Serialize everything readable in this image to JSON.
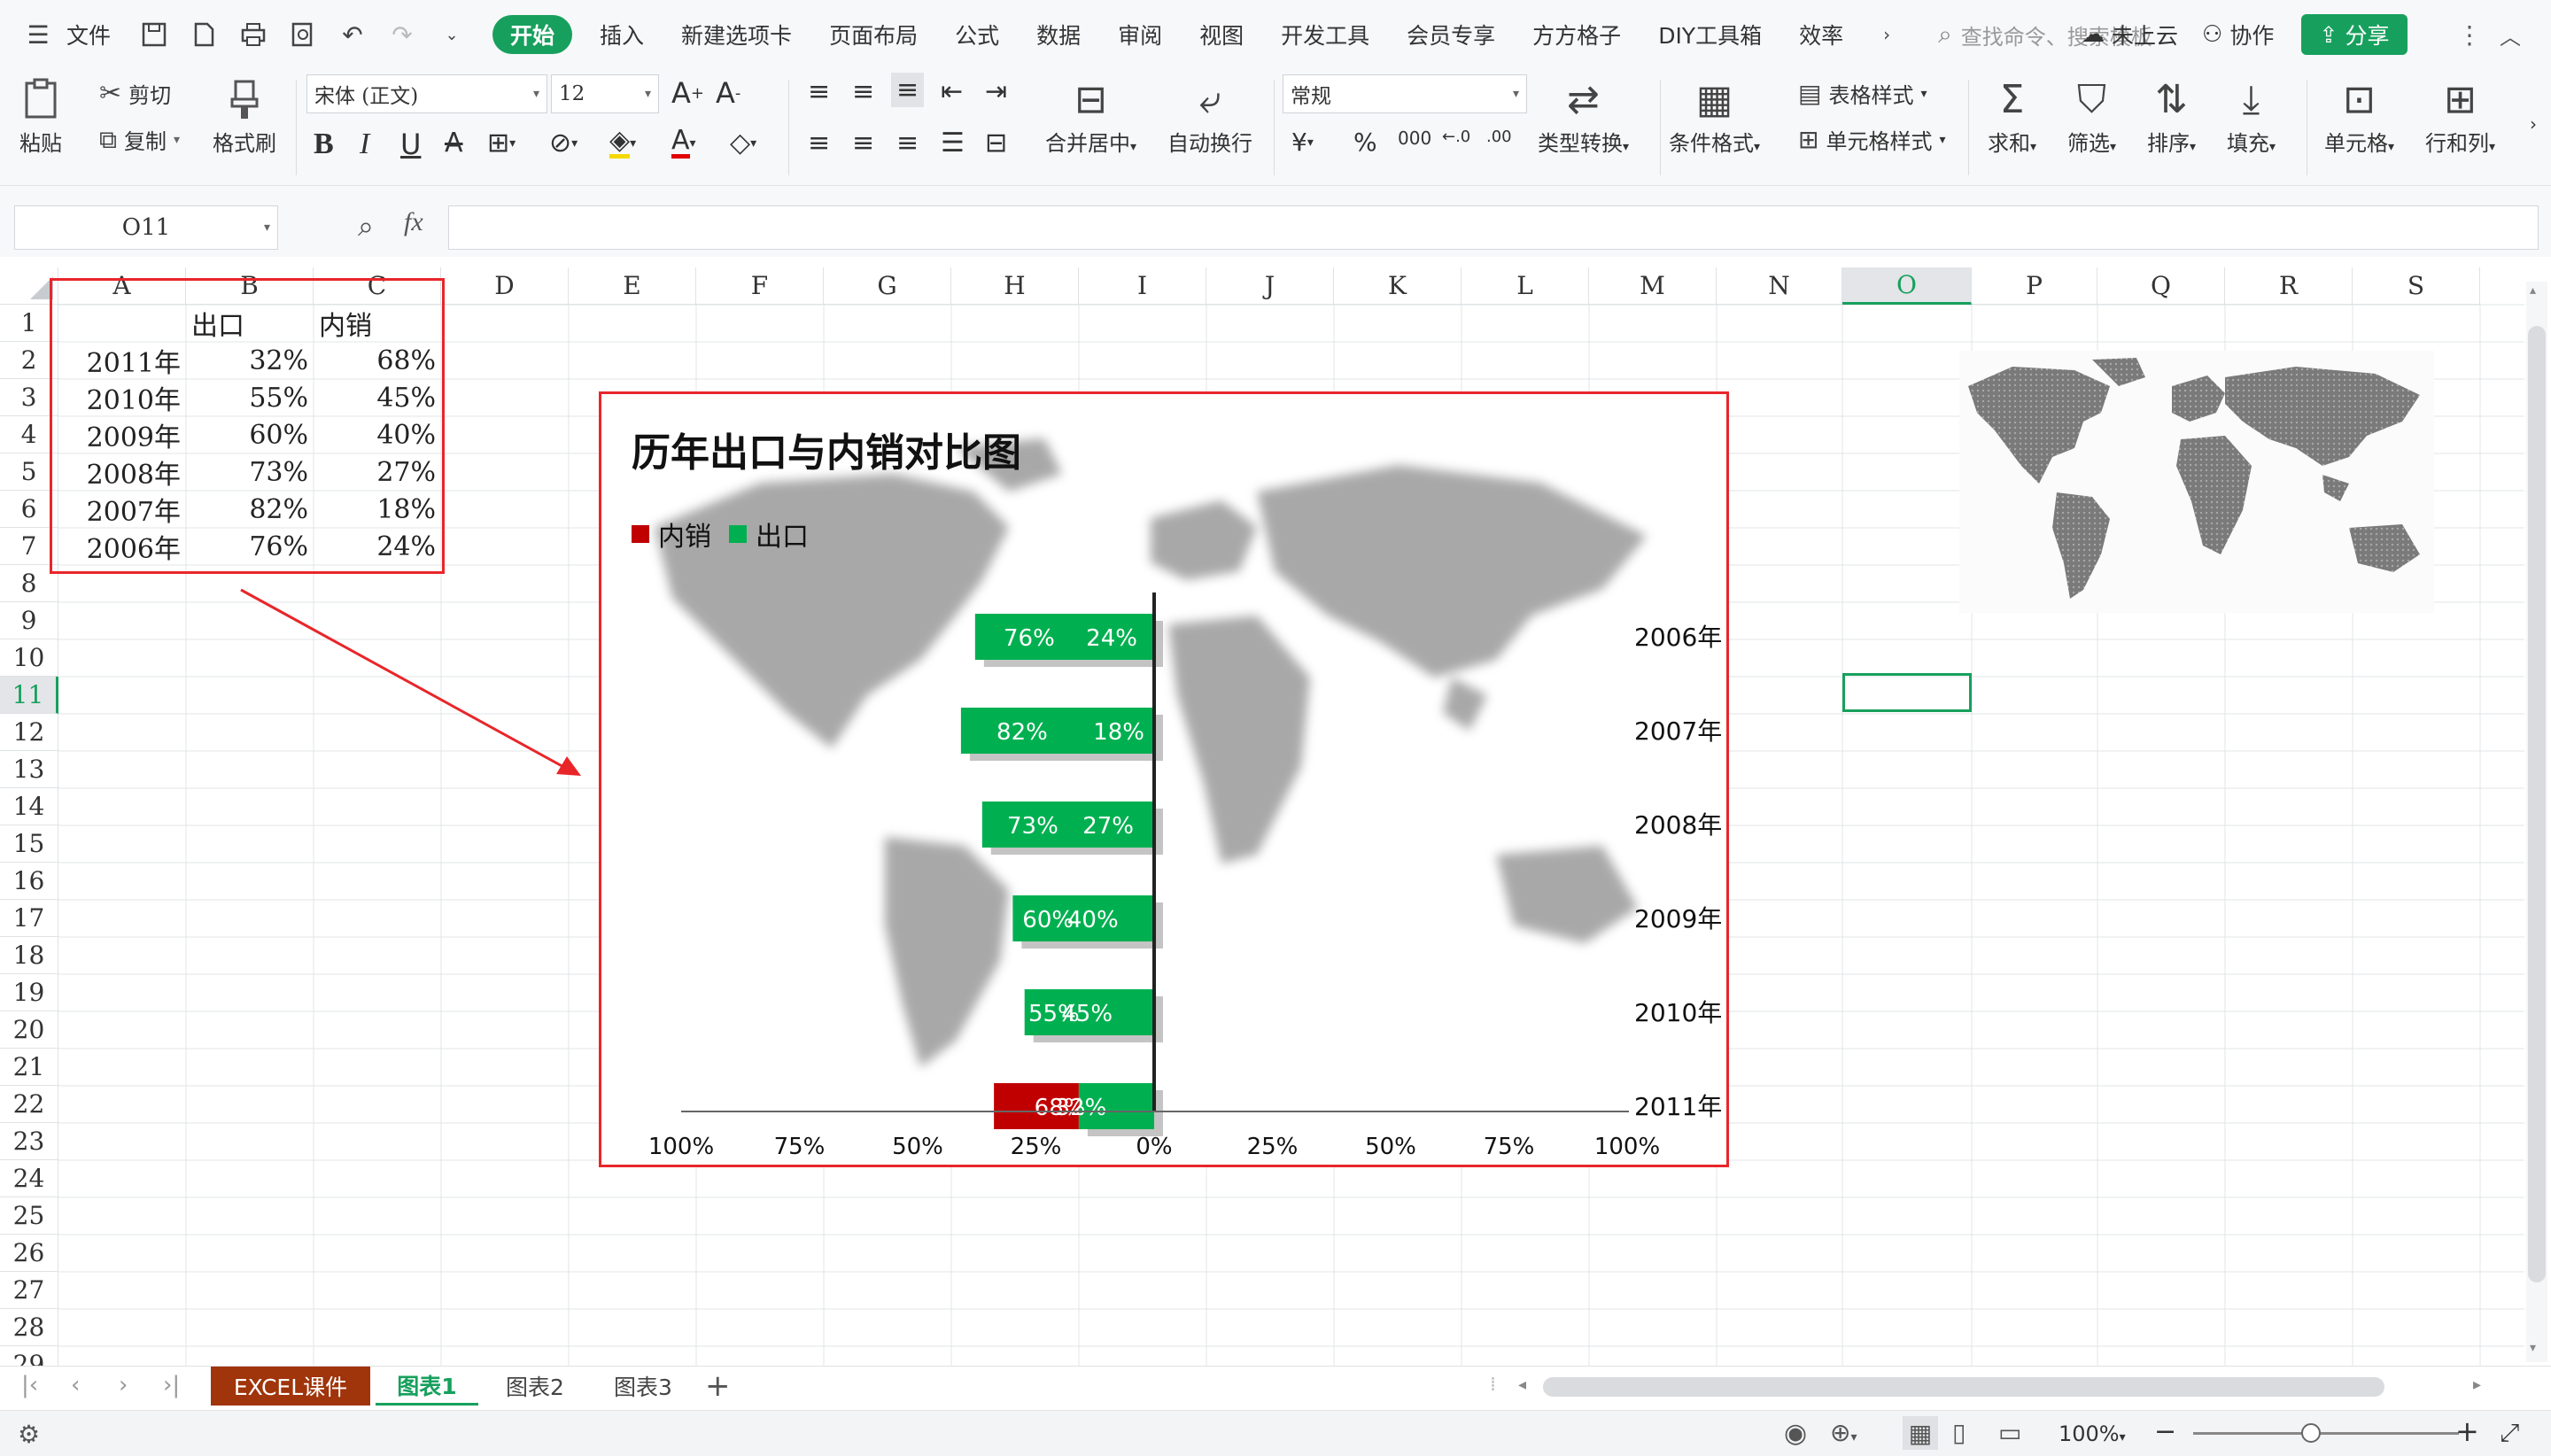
{
  "menubar": {
    "file_label": "文件",
    "tabs": [
      "开始",
      "插入",
      "新建选项卡",
      "页面布局",
      "公式",
      "数据",
      "审阅",
      "视图",
      "开发工具",
      "会员专享",
      "方方格子",
      "DIY工具箱",
      "效率"
    ],
    "active_tab": "开始",
    "search_placeholder": "查找命令、搜索模板",
    "cloud_label": "未上云",
    "collab_label": "协作",
    "share_label": "分享"
  },
  "ribbon": {
    "paste": "粘贴",
    "cut": "剪切",
    "copy": "复制",
    "format_painter": "格式刷",
    "font_name": "宋体 (正文)",
    "font_size": "12",
    "merge_center": "合并居中",
    "wrap_text": "自动换行",
    "number_format": "常规",
    "type_convert": "类型转换",
    "cond_format": "条件格式",
    "table_style": "表格样式",
    "cell_style": "单元格样式",
    "sum": "求和",
    "filter": "筛选",
    "sort": "排序",
    "fill": "填充",
    "cell": "单元格",
    "row_col": "行和列"
  },
  "formula": {
    "name_box": "O11",
    "fx": "fx",
    "value": ""
  },
  "columns": [
    "A",
    "B",
    "C",
    "D",
    "E",
    "F",
    "G",
    "H",
    "I",
    "J",
    "K",
    "L",
    "M",
    "N",
    "O",
    "P",
    "Q",
    "R",
    "S"
  ],
  "selected_column": "O",
  "rows": [
    "1",
    "2",
    "3",
    "4",
    "5",
    "6",
    "7",
    "8",
    "9",
    "10",
    "11",
    "12",
    "13",
    "14",
    "15",
    "16",
    "17",
    "18",
    "19",
    "20",
    "21",
    "22",
    "23",
    "24",
    "25",
    "26",
    "27",
    "28",
    "29"
  ],
  "selected_row": "11",
  "table": {
    "header": [
      "",
      "出口",
      "内销"
    ],
    "rows": [
      [
        "2011年",
        "32%",
        "68%"
      ],
      [
        "2010年",
        "55%",
        "45%"
      ],
      [
        "2009年",
        "60%",
        "40%"
      ],
      [
        "2008年",
        "73%",
        "27%"
      ],
      [
        "2007年",
        "82%",
        "18%"
      ],
      [
        "2006年",
        "76%",
        "24%"
      ]
    ]
  },
  "chart_data": {
    "type": "bar",
    "orientation": "horizontal",
    "title": "历年出口与内销对比图",
    "legend": [
      "内销",
      "出口"
    ],
    "legend_position": "top-left",
    "categories": [
      "2006年",
      "2007年",
      "2008年",
      "2009年",
      "2010年",
      "2011年"
    ],
    "series": [
      {
        "name": "出口",
        "values": [
          76,
          82,
          73,
          60,
          55,
          32
        ],
        "color": "#00b050"
      },
      {
        "name": "内销",
        "values": [
          24,
          18,
          27,
          40,
          45,
          68
        ],
        "color": "#c00000"
      }
    ],
    "value_labels": {
      "出口": [
        "76%",
        "82%",
        "73%",
        "60%",
        "55%",
        "32%"
      ],
      "内销": [
        "24%",
        "18%",
        "27%",
        "40%",
        "45%",
        "68%"
      ]
    },
    "x_ticks": [
      "100%",
      "75%",
      "50%",
      "25%",
      "0%",
      "25%",
      "50%",
      "75%",
      "100%"
    ],
    "xlim": [
      -100,
      100
    ],
    "grid": false,
    "background": "world-map-silhouette"
  },
  "sheet_tabs": [
    "EXCEL课件",
    "图表1",
    "图表2",
    "图表3"
  ],
  "active_sheet": "图表1",
  "status": {
    "zoom": "100%"
  },
  "colors": {
    "accent": "#17a05d",
    "export_green": "#00b050",
    "domestic_red": "#c00000",
    "annotation_red": "#e8262a",
    "tab_brown": "#a0340a"
  }
}
